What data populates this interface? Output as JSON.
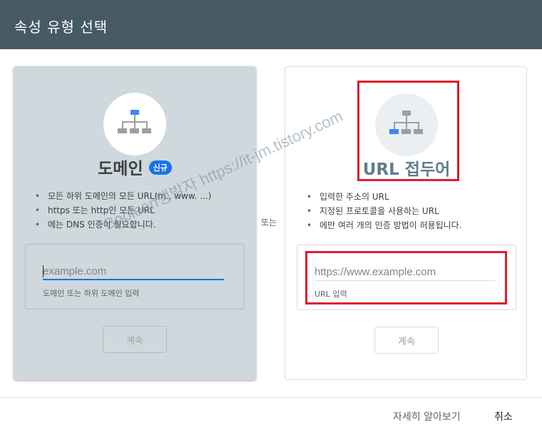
{
  "dialog": {
    "title": "속성 유형 선택"
  },
  "domain_card": {
    "title": "도메인",
    "badge": "신규",
    "bullets": [
      "모든 하위 도메인의 모든 URL(m., www. ...)",
      "https 또는 http인 모든 URL",
      "에는 DNS 인증이 필요합니다."
    ],
    "input_placeholder": "example.com",
    "input_helper": "도메인 또는 하위 도메인 입력",
    "continue_label": "계속",
    "icon": "sitemap-icon",
    "highlight_color": "#4285f4"
  },
  "separator": {
    "label": "또는"
  },
  "url_card": {
    "title": "URL 접두어",
    "bullets": [
      "입력한 주소의 URL",
      "지정된 프로토콜을 사용하는 URL",
      "에만 여러 개의 인증 방법이 허용됩니다."
    ],
    "input_placeholder": "https://www.example.com",
    "input_helper": "URL 입력",
    "continue_label": "계속",
    "icon": "sitemap-icon"
  },
  "footer": {
    "learn_more_label": "자세히 알아보기",
    "cancel_label": "취소"
  },
  "watermark": "Boolean댕발자 https://it-jm.tistory.com",
  "colors": {
    "header": "#455a64",
    "accent": "#1a73e8",
    "annotation_red": "#e21b2a"
  }
}
